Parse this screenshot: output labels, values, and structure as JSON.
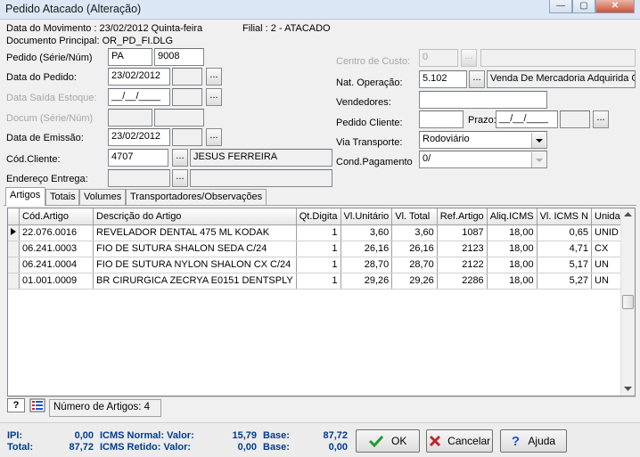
{
  "window": {
    "title": "Pedido Atacado (Alteração)",
    "minimize": "—",
    "maximize": "▢",
    "close": "✕"
  },
  "header": {
    "data_movimento": "Data do Movimento : 23/02/2012 Quinta-feira",
    "filial": "Filial :  2 - ATACADO",
    "documento": "Documento Principal: OR_PD_FI.DLG"
  },
  "left": {
    "pedido_label": "Pedido (Série/Núm)",
    "pedido_serie": "PA",
    "pedido_num": "9008",
    "data_pedido_label": "Data do Pedido:",
    "data_pedido": "23/02/2012",
    "data_saida_label": "Data Saída Estoque:",
    "data_saida": "__/__/____",
    "docum_label": "Docum (Série/Núm)",
    "emissao_label": "Data de Emissão:",
    "emissao": "23/02/2012",
    "cliente_label": "Cód.Cliente:",
    "cliente_cod": "4707",
    "cliente_nome": "JESUS FERREIRA",
    "endereco_label": "Endereço Entrega:",
    "ellipsis": "..."
  },
  "right": {
    "centro_label": "Centro de Custo:",
    "centro_val": "0",
    "natop_label": "Nat. Operação:",
    "natop_cod": "5.102",
    "natop_desc": "Venda De Mercadoria Adquirida Ou",
    "vendedores_label": "Vendedores:",
    "pedido_cliente_label": "Pedido Cliente:",
    "prazo_label": "Prazo:",
    "prazo_val": "__/__/____",
    "via_label": "Via Transporte:",
    "via_val": "Rodoviário",
    "cond_label": "Cond.Pagamento",
    "cond_val": "0/"
  },
  "tabs": [
    {
      "label": "Artigos"
    },
    {
      "label": "Totais"
    },
    {
      "label": "Volumes"
    },
    {
      "label": "Transportadores/Observações"
    }
  ],
  "grid": {
    "headers": [
      "Cód.Artigo",
      "Descrição do Artigo",
      "Qt.Digita",
      "Vl.Unitário",
      "Vl. Total",
      "Ref.Artigo",
      "Aliq.ICMS",
      "Vl. ICMS N",
      "Unidade"
    ],
    "rows": [
      [
        "22.076.0016",
        "REVELADOR DENTAL 475 ML KODAK",
        "1",
        "3,60",
        "3,60",
        "1087",
        "18,00",
        "0,65",
        "UNID"
      ],
      [
        "06.241.0003",
        "FIO DE SUTURA SHALON SEDA C/24",
        "1",
        "26,16",
        "26,16",
        "2123",
        "18,00",
        "4,71",
        "CX"
      ],
      [
        "06.241.0004",
        "FIO DE SUTURA NYLON  SHALON CX C/24",
        "1",
        "28,70",
        "28,70",
        "2122",
        "18,00",
        "5,17",
        "UN"
      ],
      [
        "01.001.0009",
        "BR CIRURGICA ZECRYA  E0151  DENTSPLY",
        "1",
        "29,26",
        "29,26",
        "2286",
        "18,00",
        "5,27",
        "UN"
      ]
    ]
  },
  "status": {
    "help_icon": "?",
    "num_artigos": "Número de Artigos: 4"
  },
  "footer": {
    "ipi_label": "IPI:",
    "ipi_val": "0,00",
    "total_label": "Total:",
    "total_val": "87,72",
    "icms_normal_label": "ICMS Normal: Valor:",
    "icms_normal_val": "15,79",
    "icms_retido_label": "ICMS Retido: Valor:",
    "icms_retido_val": "0,00",
    "base_label": "Base:",
    "base1": "87,72",
    "base2": "0,00"
  },
  "buttons": {
    "ok": "OK",
    "cancel": "Cancelar",
    "help": "Ajuda"
  },
  "colors": {
    "ok_green": "#1f9b2e",
    "cancel_red": "#c0262c",
    "help_blue": "#1a56c4",
    "footer_text": "#003c8f"
  }
}
